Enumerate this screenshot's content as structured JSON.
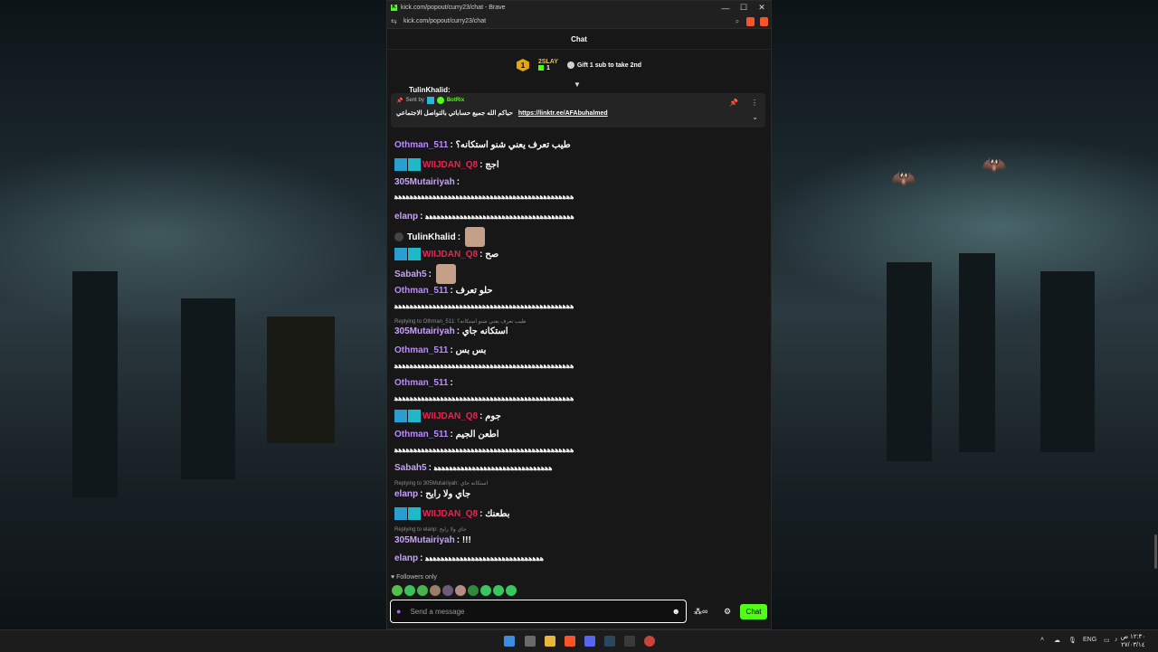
{
  "window": {
    "title": "kick.com/popout/curry23/chat - Brave",
    "url": "kick.com/popout/curry23/chat",
    "controls": [
      "—",
      "☐",
      "✕"
    ]
  },
  "chat": {
    "header": "Chat",
    "leaderboard": {
      "rank": "1",
      "gifter": "2SLAY",
      "count": "1",
      "message": "Gift 1 sub to take 2nd"
    },
    "pinned": {
      "sent_by_label": "Sent by",
      "sender": "BotRix",
      "text": "حياكم الله جميع حساباتي بالتواصل الاجتماعي",
      "link": "https://linktr.ee/AFAbuhalmed"
    },
    "partial_top": "TulinKhalid:",
    "messages": [
      {
        "user": "Othman_511",
        "text": "طيب تعرف يعني شنو استكانه؟"
      },
      {
        "user": "WIIJDAN_Q8",
        "text": "اجج"
      },
      {
        "user": "305Mutairiyah",
        "text": ""
      },
      {
        "user": "",
        "text": "ﮬﮬﮬﮬﮬﮬﮬﮬﮬﮬﮬﮬﮬﮬﮬﮬﮬﮬﮬﮬﮬﮬﮬﮬﮬﮬﮬﮬﮬﮬﮬﮬﮬﮬﮬﮬﮬﮬﮬﮬﮬﮬﮬﮬﮬﮬﮬ"
      },
      {
        "user": "elanp",
        "text": "ﮬﮬﮬﮬﮬﮬﮬﮬﮬﮬﮬﮬﮬﮬﮬﮬﮬﮬﮬﮬﮬﮬﮬﮬﮬﮬﮬﮬﮬﮬﮬﮬﮬﮬﮬﮬﮬﮬﮬ"
      },
      {
        "user": "TulinKhalid",
        "text": ""
      },
      {
        "user": "WIIJDAN_Q8",
        "text": "صح"
      },
      {
        "user": "Sabah5",
        "text": ""
      },
      {
        "user": "Othman_511",
        "text": "حلو تعرف"
      },
      {
        "user": "",
        "text": "ﮬﮬﮬﮬﮬﮬﮬﮬﮬﮬﮬﮬﮬﮬﮬﮬﮬﮬﮬﮬﮬﮬﮬﮬﮬﮬﮬﮬﮬﮬﮬﮬﮬﮬﮬﮬﮬﮬﮬﮬﮬﮬﮬﮬﮬﮬﮬ"
      },
      {
        "user": "305Mutairiyah",
        "text": "استكانه جاي"
      },
      {
        "user": "Othman_511",
        "text": "بس بس"
      },
      {
        "user": "",
        "text": "ﮬﮬﮬﮬﮬﮬﮬﮬﮬﮬﮬﮬﮬﮬﮬﮬﮬﮬﮬﮬﮬﮬﮬﮬﮬﮬﮬﮬﮬﮬﮬﮬﮬﮬﮬﮬﮬﮬﮬﮬﮬﮬﮬﮬﮬﮬﮬ"
      },
      {
        "user": "Othman_511",
        "text": ""
      },
      {
        "user": "",
        "text": "ﮬﮬﮬﮬﮬﮬﮬﮬﮬﮬﮬﮬﮬﮬﮬﮬﮬﮬﮬﮬﮬﮬﮬﮬﮬﮬﮬﮬﮬﮬﮬﮬﮬﮬﮬﮬﮬﮬﮬﮬﮬﮬﮬﮬﮬﮬﮬ"
      },
      {
        "user": "WIIJDAN_Q8",
        "text": "جوم"
      },
      {
        "user": "Othman_511",
        "text": "اطعن الجيم"
      },
      {
        "user": "",
        "text": "ﮬﮬﮬﮬﮬﮬﮬﮬﮬﮬﮬﮬﮬﮬﮬﮬﮬﮬﮬﮬﮬﮬﮬﮬﮬﮬﮬﮬﮬﮬﮬﮬﮬﮬﮬﮬﮬﮬﮬﮬﮬﮬﮬﮬﮬﮬﮬ"
      },
      {
        "user": "Sabah5",
        "text": "ﮬﮬﮬﮬﮬﮬﮬﮬﮬﮬﮬﮬﮬﮬﮬﮬﮬﮬﮬﮬﮬﮬﮬﮬﮬﮬﮬﮬﮬﮬﮬ"
      },
      {
        "user": "elanp",
        "text": "جاي ولا رايح"
      },
      {
        "user": "WIIJDAN_Q8",
        "text": "بطعنك"
      },
      {
        "user": "305Mutairiyah",
        "text": "!!!"
      },
      {
        "user": "elanp",
        "text": "ﮬﮬﮬﮬﮬﮬﮬﮬﮬﮬﮬﮬﮬﮬﮬﮬﮬﮬﮬﮬﮬﮬﮬﮬﮬﮬﮬﮬﮬﮬﮬ"
      }
    ],
    "replies": [
      {
        "text": "Replying to Othman_511: طيب تعرف يعني شنو استكانه؟"
      },
      {
        "text": "Replying to 305Mutairiyah: استكانه جاي"
      },
      {
        "text": "Replying to elanp: جاي ولا رايح"
      }
    ],
    "followers_only": "Followers only",
    "composer": {
      "placeholder": "Send a message",
      "send_label": "Chat"
    }
  },
  "system": {
    "lang": "ENG",
    "time": "١٢:٣٠ ص",
    "date": "٢٧/٠٣/١٤"
  },
  "colors": {
    "kick_green": "#53fc18",
    "username_purple": "#b98bff",
    "username_red": "#e6264f"
  }
}
